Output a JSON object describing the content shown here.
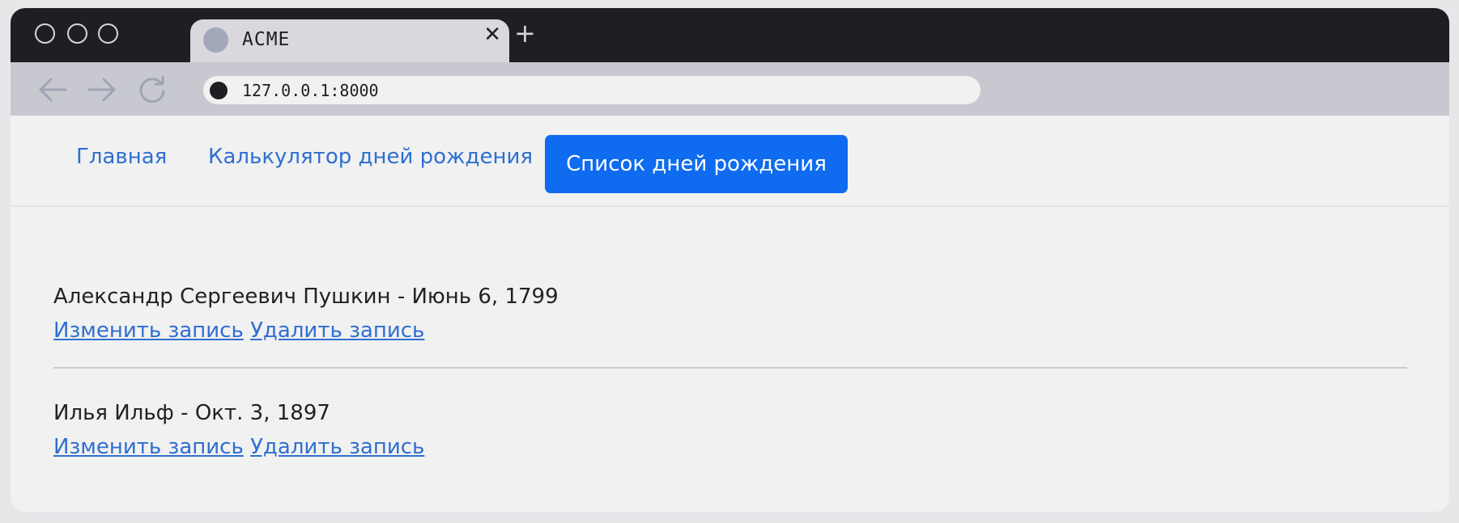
{
  "browser": {
    "tab_title": "ACME",
    "tab_close": "✕",
    "new_tab": "+",
    "url": "127.0.0.1:8000"
  },
  "nav": {
    "home": "Главная",
    "calculator": "Калькулятор дней рождения",
    "list": "Список дней рождения"
  },
  "entries": [
    {
      "text": "Александр Сергеевич Пушкин - Июнь 6, 1799",
      "edit": "Изменить запись",
      "delete": "Удалить запись"
    },
    {
      "text": "Илья Ильф - Окт. 3, 1897",
      "edit": "Изменить запись",
      "delete": "Удалить запись"
    }
  ],
  "colors": {
    "accent": "#0f6bef",
    "link": "#2f6fd0",
    "titlebar": "#1e1f23"
  }
}
